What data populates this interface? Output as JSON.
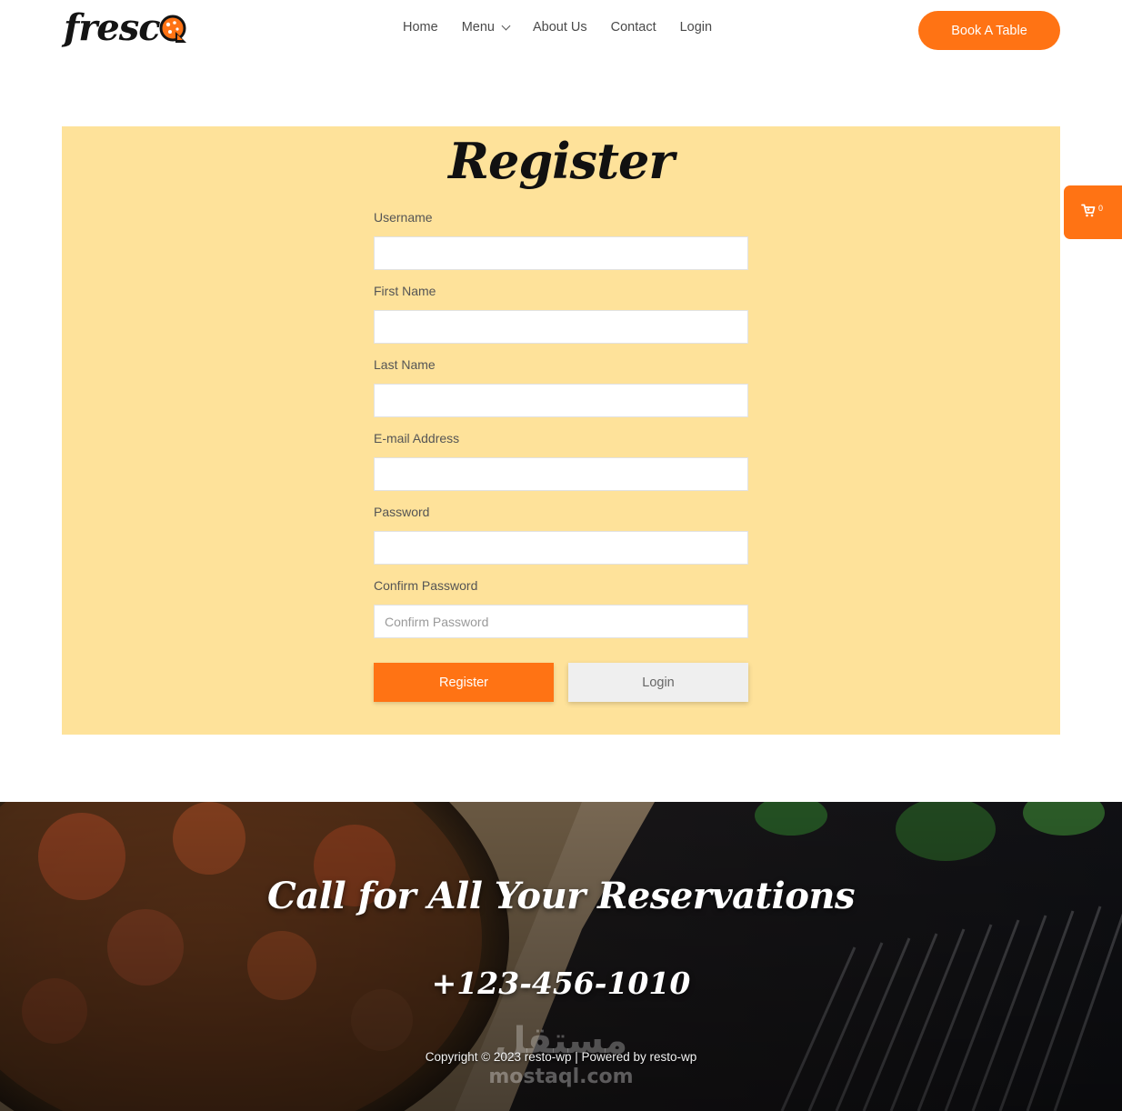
{
  "brand": {
    "logo_text": "fresc",
    "accent_color": "#ff7314",
    "panel_color": "#fee29a"
  },
  "nav": {
    "items": [
      {
        "label": "Home"
      },
      {
        "label": "Menu",
        "has_dropdown": true
      },
      {
        "label": "About Us"
      },
      {
        "label": "Contact"
      },
      {
        "label": "Login"
      }
    ],
    "book_button": "Book A Table"
  },
  "cart": {
    "icon": "cart-icon",
    "count": "0"
  },
  "register": {
    "title": "Register",
    "fields": [
      {
        "label": "Username",
        "value": "",
        "placeholder": ""
      },
      {
        "label": "First Name",
        "value": "",
        "placeholder": ""
      },
      {
        "label": "Last Name",
        "value": "",
        "placeholder": ""
      },
      {
        "label": "E-mail Address",
        "value": "",
        "placeholder": ""
      },
      {
        "label": "Password",
        "value": "",
        "placeholder": ""
      },
      {
        "label": "Confirm Password",
        "value": "",
        "placeholder": "Confirm Password"
      }
    ],
    "register_button": "Register",
    "login_button": "Login"
  },
  "footer": {
    "heading": "Call for All Your Reservations",
    "phone": "+123-456-1010",
    "copyright": "Copyright © 2023 resto-wp | Powered by resto-wp",
    "watermark_ar": "مستقل",
    "watermark_en": "mostaql.com"
  }
}
